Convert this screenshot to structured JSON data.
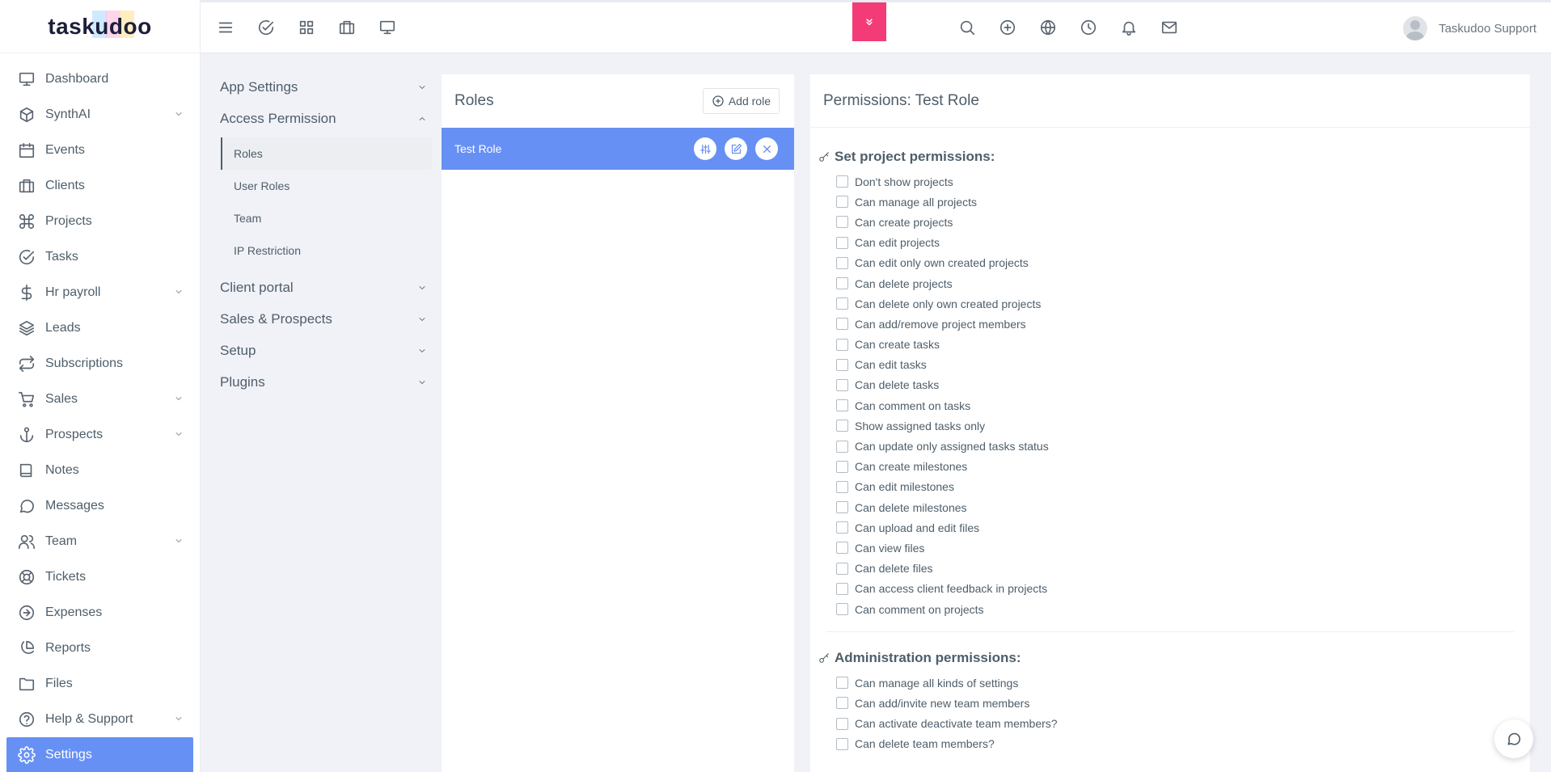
{
  "brand": {
    "logo_text": "taskudoo"
  },
  "sidebar": {
    "items": [
      {
        "label": "Dashboard",
        "icon": "monitor-icon",
        "has_submenu": false
      },
      {
        "label": "SynthAI",
        "icon": "cube-icon",
        "has_submenu": true
      },
      {
        "label": "Events",
        "icon": "calendar-icon",
        "has_submenu": false
      },
      {
        "label": "Clients",
        "icon": "briefcase-icon",
        "has_submenu": false
      },
      {
        "label": "Projects",
        "icon": "command-icon",
        "has_submenu": false
      },
      {
        "label": "Tasks",
        "icon": "check-circle-icon",
        "has_submenu": false
      },
      {
        "label": "Hr payroll",
        "icon": "dollar-icon",
        "has_submenu": true
      },
      {
        "label": "Leads",
        "icon": "layers-icon",
        "has_submenu": false
      },
      {
        "label": "Subscriptions",
        "icon": "repeat-icon",
        "has_submenu": false
      },
      {
        "label": "Sales",
        "icon": "cart-icon",
        "has_submenu": true
      },
      {
        "label": "Prospects",
        "icon": "anchor-icon",
        "has_submenu": true
      },
      {
        "label": "Notes",
        "icon": "book-icon",
        "has_submenu": false
      },
      {
        "label": "Messages",
        "icon": "message-icon",
        "has_submenu": false
      },
      {
        "label": "Team",
        "icon": "users-icon",
        "has_submenu": true
      },
      {
        "label": "Tickets",
        "icon": "life-buoy-icon",
        "has_submenu": false
      },
      {
        "label": "Expenses",
        "icon": "arrow-circle-icon",
        "has_submenu": false
      },
      {
        "label": "Reports",
        "icon": "pie-chart-icon",
        "has_submenu": false
      },
      {
        "label": "Files",
        "icon": "folder-icon",
        "has_submenu": false
      },
      {
        "label": "Help & Support",
        "icon": "help-circle-icon",
        "has_submenu": true
      },
      {
        "label": "Settings",
        "icon": "gear-icon",
        "has_submenu": false,
        "active": true
      }
    ]
  },
  "topbar": {
    "left_icons": [
      "menu-icon",
      "check-circle-icon",
      "grid-icon",
      "briefcase-icon",
      "monitor-icon"
    ],
    "right_icons": [
      "search-icon",
      "plus-circle-icon",
      "globe-icon",
      "clock-icon",
      "bell-icon",
      "mail-icon"
    ],
    "user_name": "Taskudoo Support",
    "accent_color": "#f23b77"
  },
  "settings_menu": {
    "groups": [
      {
        "label": "App Settings",
        "expanded": false,
        "items": []
      },
      {
        "label": "Access Permission",
        "expanded": true,
        "items": [
          {
            "label": "Roles",
            "active": true
          },
          {
            "label": "User Roles"
          },
          {
            "label": "Team"
          },
          {
            "label": "IP Restriction"
          }
        ]
      },
      {
        "label": "Client portal",
        "expanded": false,
        "items": []
      },
      {
        "label": "Sales & Prospects",
        "expanded": false,
        "items": []
      },
      {
        "label": "Setup",
        "expanded": false,
        "items": []
      },
      {
        "label": "Plugins",
        "expanded": false,
        "items": []
      }
    ]
  },
  "roles_panel": {
    "title": "Roles",
    "add_button": "Add role",
    "roles": [
      {
        "name": "Test Role",
        "selected": true
      }
    ],
    "selected_color": "#6690f4"
  },
  "permissions_panel": {
    "title": "Permissions: Test Role",
    "sections": [
      {
        "title": "Set project permissions:",
        "items": [
          "Don't show projects",
          "Can manage all projects",
          "Can create projects",
          "Can edit projects",
          "Can edit only own created projects",
          "Can delete projects",
          "Can delete only own created projects",
          "Can add/remove project members",
          "Can create tasks",
          "Can edit tasks",
          "Can delete tasks",
          "Can comment on tasks",
          "Show assigned tasks only",
          "Can update only assigned tasks status",
          "Can create milestones",
          "Can edit milestones",
          "Can delete milestones",
          "Can upload and edit files",
          "Can view files",
          "Can delete files",
          "Can access client feedback in projects",
          "Can comment on projects"
        ]
      },
      {
        "title": "Administration permissions:",
        "items": [
          "Can manage all kinds of settings",
          "Can add/invite new team members",
          "Can activate deactivate team members?",
          "Can delete team members?"
        ]
      }
    ]
  }
}
